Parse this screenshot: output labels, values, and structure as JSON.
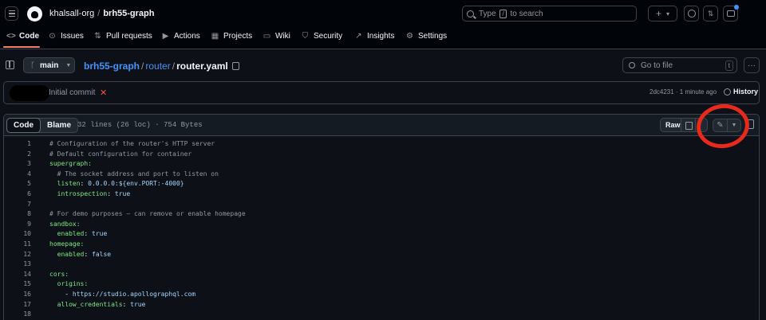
{
  "topbar": {
    "owner": "khalsall-org",
    "separator": "/",
    "repo": "brh55-graph",
    "search_prefix": "Type",
    "search_key": "/",
    "search_suffix": "to search",
    "plus_icon": "+",
    "caret_icon": "▾"
  },
  "reponav": {
    "tabs": [
      {
        "label": "Code",
        "icon": "code-icon"
      },
      {
        "label": "Issues",
        "icon": "issue-icon"
      },
      {
        "label": "Pull requests",
        "icon": "pull-request-icon"
      },
      {
        "label": "Actions",
        "icon": "play-icon"
      },
      {
        "label": "Projects",
        "icon": "table-icon"
      },
      {
        "label": "Wiki",
        "icon": "book-icon"
      },
      {
        "label": "Security",
        "icon": "shield-icon"
      },
      {
        "label": "Insights",
        "icon": "graph-icon"
      },
      {
        "label": "Settings",
        "icon": "gear-icon"
      }
    ],
    "active_tab": "Code",
    "accent_color": "#f78166"
  },
  "filebar": {
    "branch": "main",
    "breadcrumb_repo": "brh55-graph",
    "breadcrumb_dir": "router",
    "slash": "/",
    "filename": "router.yaml",
    "go_to_file_placeholder": "Go to file",
    "go_to_file_key": "t"
  },
  "commit": {
    "message": "Initial commit",
    "status_mark": "✕",
    "sha_time": "2dc4231 · 1 minute ago",
    "history_label": "History"
  },
  "code_view": {
    "tab_code": "Code",
    "tab_blame": "Blame",
    "file_info": "32 lines (26 loc) · 754 Bytes",
    "raw_label": "Raw",
    "edit_icon": "✎",
    "lines": [
      {
        "n": "1",
        "text": "# Configuration of the router's HTTP server",
        "kind": "comment"
      },
      {
        "n": "2",
        "text": "# Default configuration for container",
        "kind": "comment"
      },
      {
        "n": "3",
        "text": "supergraph:",
        "kind": "key"
      },
      {
        "n": "4",
        "text": "  # The socket address and port to listen on",
        "kind": "comment"
      },
      {
        "n": "5",
        "key": "  listen",
        "value": "0.0.0.0:${env.PORT:-4000}",
        "kind": "pair"
      },
      {
        "n": "6",
        "key": "  introspection",
        "value": "true",
        "kind": "pair"
      },
      {
        "n": "7",
        "text": "",
        "kind": "plain"
      },
      {
        "n": "8",
        "text": "# For demo purposes — can remove or enable homepage",
        "kind": "comment"
      },
      {
        "n": "9",
        "text": "sandbox:",
        "kind": "key"
      },
      {
        "n": "10",
        "key": "  enabled",
        "value": "true",
        "kind": "pair"
      },
      {
        "n": "11",
        "text": "homepage:",
        "kind": "key"
      },
      {
        "n": "12",
        "key": "  enabled",
        "value": "false",
        "kind": "pair"
      },
      {
        "n": "13",
        "text": "",
        "kind": "plain"
      },
      {
        "n": "14",
        "text": "cors:",
        "kind": "key"
      },
      {
        "n": "15",
        "text": "  origins:",
        "kind": "key"
      },
      {
        "n": "16",
        "dash": "    - ",
        "value": "https://studio.apollographql.com",
        "kind": "list"
      },
      {
        "n": "17",
        "key": "  allow_credentials",
        "value": "true",
        "kind": "pair"
      },
      {
        "n": "18",
        "text": "",
        "kind": "plain"
      }
    ]
  }
}
